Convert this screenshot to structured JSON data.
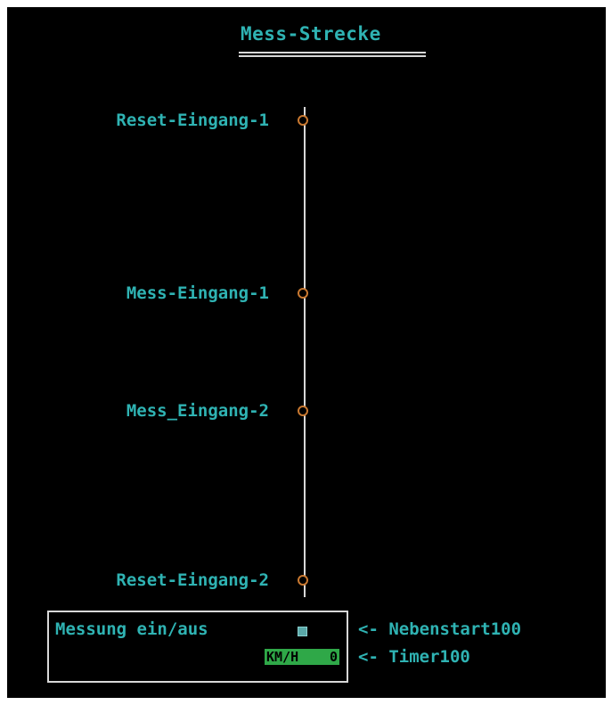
{
  "title": "Mess-Strecke",
  "track": {
    "sensors": [
      {
        "label": "Reset-Eingang-1"
      },
      {
        "label": "Mess-Eingang-1"
      },
      {
        "label": "Mess_Eingang-2"
      },
      {
        "label": "Reset-Eingang-2"
      }
    ]
  },
  "control": {
    "label": "Messung ein/aus",
    "display_unit": "KM/H",
    "display_value": "0",
    "arrows": [
      {
        "text": "<- Nebenstart100"
      },
      {
        "text": "<- Timer100"
      }
    ]
  },
  "colors": {
    "background": "#000000",
    "text": "#2fb3b3",
    "line": "#d8d8d8",
    "sensor": "#c87830",
    "display": "#2fa848"
  }
}
